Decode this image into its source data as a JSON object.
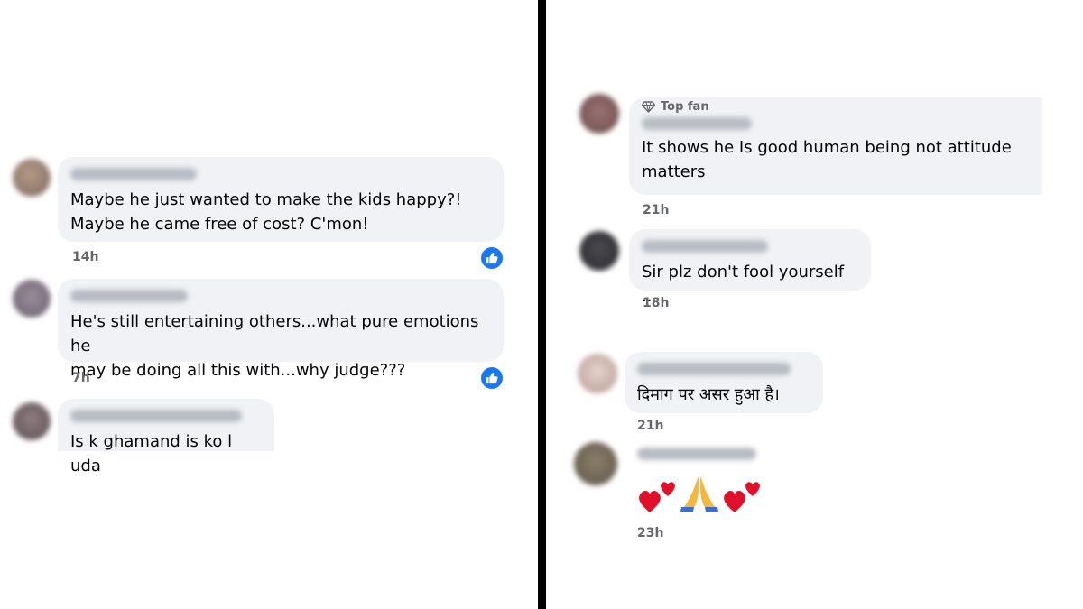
{
  "left_comments": [
    {
      "text": "Maybe he just wanted to make the kids happy?!\nMaybe he came free of cost? C'mon!",
      "time": "14h",
      "reaction": "like"
    },
    {
      "text": "He's still entertaining others...what pure emotions he\nmay be doing all this with...why judge???",
      "time": "7h",
      "reaction": "like"
    },
    {
      "text": "Is k ghamand is ko l uda",
      "time": ""
    }
  ],
  "right_comments": [
    {
      "badge": "Top fan",
      "badge_icon": "diamond-icon",
      "text": "It shows he Is good human being not attitude\nmatters",
      "time": "21h"
    },
    {
      "text": "Sir plz don't fool yourself ..",
      "time": "18h"
    },
    {
      "text": "दिमाग पर असर हुआ है।",
      "time": "21h"
    },
    {
      "emojis": [
        "two-hearts-icon",
        "folded-hands-icon",
        "two-hearts-icon"
      ],
      "time": "23h"
    }
  ],
  "colors": {
    "bubble": "#f0f2f5",
    "like": "#1877f2",
    "divider": "#000000"
  }
}
